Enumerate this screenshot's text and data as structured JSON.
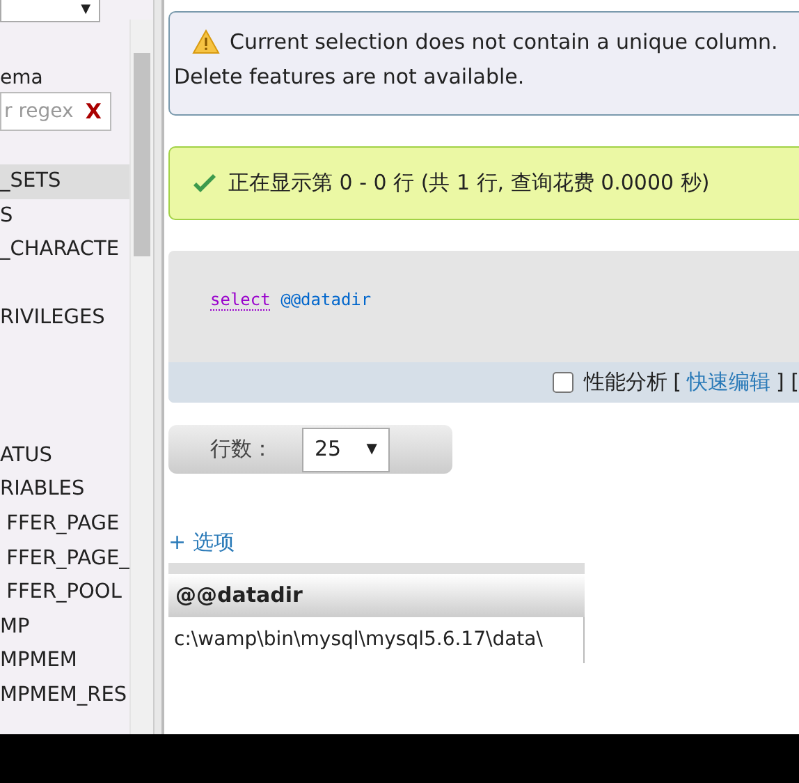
{
  "sidebar": {
    "database_select": {
      "caret": "▼"
    },
    "schema_label": "ema",
    "filter": {
      "placeholder": "r regex",
      "clear": "X"
    },
    "items": [
      {
        "kind": "text",
        "label": "_SETS",
        "selected": true
      },
      {
        "kind": "text",
        "label": "S",
        "selected": false
      },
      {
        "kind": "text",
        "label": "_CHARACTE",
        "selected": false
      },
      {
        "kind": "blank"
      },
      {
        "kind": "text",
        "label": "RIVILEGES",
        "selected": false
      },
      {
        "kind": "blank"
      },
      {
        "kind": "blank"
      },
      {
        "kind": "blank"
      },
      {
        "kind": "text",
        "label": "ATUS",
        "selected": false
      },
      {
        "kind": "text",
        "label": "RIABLES",
        "selected": false
      },
      {
        "kind": "text",
        "label": " FFER_PAGE",
        "selected": false
      },
      {
        "kind": "text",
        "label": " FFER_PAGE_",
        "selected": false
      },
      {
        "kind": "text",
        "label": " FFER_POOL",
        "selected": false
      },
      {
        "kind": "text",
        "label": "MP",
        "selected": false
      },
      {
        "kind": "text",
        "label": "MPMEM",
        "selected": false
      },
      {
        "kind": "text",
        "label": "MPMEM_RES",
        "selected": false
      }
    ]
  },
  "notices": [
    {
      "kind": "warning",
      "lines": [
        "Current selection does not contain a unique column.",
        "Delete features are not available."
      ]
    },
    {
      "kind": "success",
      "lines": [
        "正在显示第 0 - 0 行 (共 1 行, 查询花费 0.0000 秒)"
      ]
    }
  ],
  "query": {
    "keyword": "select",
    "variable": "@@datadir",
    "profiling": {
      "label": "性能分析",
      "checked": false
    },
    "bracket_open": "[",
    "edit_link": "快速编辑",
    "bracket_tail": "] ["
  },
  "rows_control": {
    "label": "行数：",
    "value": "25",
    "caret": "▼"
  },
  "options_link": "+ 选项",
  "table": {
    "columns": [
      "@@datadir"
    ],
    "rows": [
      [
        "c:\\wamp\\bin\\mysql\\mysql5.6.17\\data\\"
      ]
    ]
  }
}
